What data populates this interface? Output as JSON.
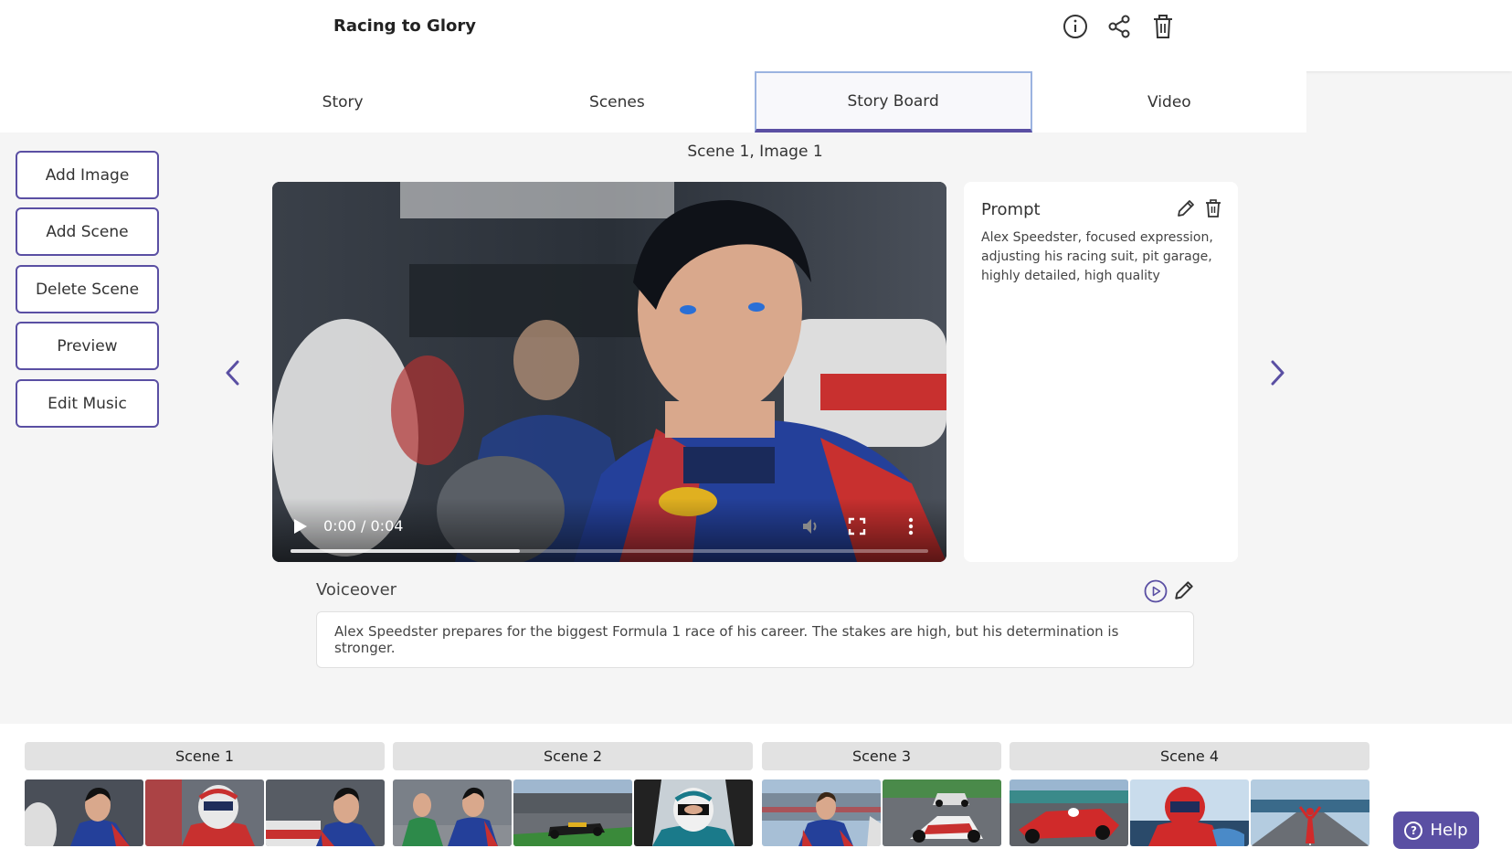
{
  "header": {
    "title": "Racing to Glory",
    "icons": [
      "info-icon",
      "share-icon",
      "trash-icon"
    ]
  },
  "tabs": [
    {
      "label": "Story"
    },
    {
      "label": "Scenes"
    },
    {
      "label": "Story Board",
      "active": true
    },
    {
      "label": "Video"
    }
  ],
  "sidebar": {
    "buttons": [
      {
        "label": "Add Image"
      },
      {
        "label": "Add Scene"
      },
      {
        "label": "Delete Scene"
      },
      {
        "label": "Preview"
      },
      {
        "label": "Edit Music"
      }
    ]
  },
  "main": {
    "scene_label": "Scene 1, Image 1",
    "video": {
      "time": "0:00 / 0:04",
      "buffered_fraction": 0.36
    },
    "prompt": {
      "title": "Prompt",
      "text": "Alex Speedster, focused expression, adjusting his racing suit, pit garage, highly detailed, high quality"
    },
    "voiceover": {
      "title": "Voiceover",
      "text": "Alex Speedster prepares for the biggest Formula 1 race of his career. The stakes are high, but his determination is stronger."
    }
  },
  "timeline": {
    "scenes": [
      {
        "label": "Scene 1",
        "thumbs": [
          "driver-in-garage",
          "driver-with-helmet",
          "driver-at-car"
        ]
      },
      {
        "label": "Scene 2",
        "thumbs": [
          "drivers-pit-lane",
          "car-on-track",
          "driver-in-cockpit"
        ]
      },
      {
        "label": "Scene 3",
        "thumbs": [
          "driver-at-grandstand",
          "cars-racing"
        ]
      },
      {
        "label": "Scene 4",
        "thumbs": [
          "red-car-on-track",
          "driver-in-car",
          "driver-celebrating"
        ]
      }
    ]
  },
  "help": {
    "label": "Help"
  },
  "colors": {
    "accent": "#5a4fa3",
    "tab_active_border": "#9bb3e0",
    "background": "#f5f5f5",
    "scene_header": "#e2e2e2"
  }
}
